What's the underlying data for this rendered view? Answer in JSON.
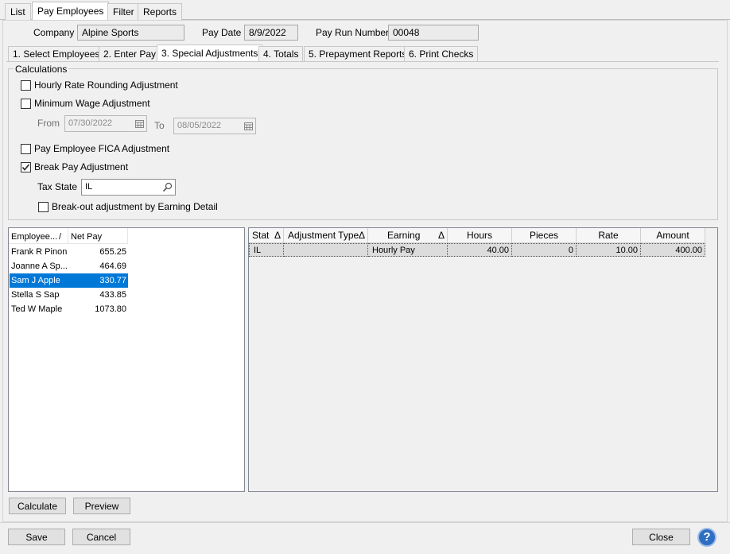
{
  "top_tabs": [
    "List",
    "Pay Employees",
    "Filter",
    "Reports"
  ],
  "header": {
    "company_label": "Company",
    "company_value": "Alpine Sports",
    "paydate_label": "Pay Date",
    "paydate_value": "8/9/2022",
    "payrun_label": "Pay Run Number",
    "payrun_value": "00048"
  },
  "step_tabs": [
    "1. Select Employees",
    "2. Enter Pay",
    "3. Special Adjustments",
    "4. Totals",
    "5. Prepayment Reports",
    "6. Print Checks"
  ],
  "calc": {
    "group_label": "Calculations",
    "hourly_rounding": "Hourly Rate Rounding Adjustment",
    "min_wage": "Minimum Wage Adjustment",
    "from_label": "From",
    "from_value": "07/30/2022",
    "to_label": "To",
    "to_value": "08/05/2022",
    "fica": "Pay Employee FICA Adjustment",
    "break_pay": "Break Pay Adjustment",
    "tax_state_label": "Tax State",
    "tax_state_value": "IL",
    "breakout": "Break-out adjustment by Earning Detail"
  },
  "emp_list": {
    "col_employee": "Employee...",
    "sort_glyph": "/",
    "col_netpay": "Net Pay",
    "rows": [
      {
        "name": "Frank R Pinon",
        "net": "655.25"
      },
      {
        "name": "Joanne A Sp...",
        "net": "464.69"
      },
      {
        "name": "Sam J Apple",
        "net": "330.77"
      },
      {
        "name": "Stella S Sap",
        "net": "433.85"
      },
      {
        "name": "Ted W Maple",
        "net": "1073.80"
      }
    ]
  },
  "adj_grid": {
    "headers": [
      "Stat",
      "Adjustment Type",
      "Earning",
      "Hours",
      "Pieces",
      "Rate",
      "Amount"
    ],
    "sort_glyph": "Δ",
    "row": {
      "stat": "IL",
      "adj_type": "",
      "earning": "Hourly Pay",
      "hours": "40.00",
      "pieces": "0",
      "rate": "10.00",
      "amount": "400.00"
    }
  },
  "buttons": {
    "calculate": "Calculate",
    "preview": "Preview",
    "save": "Save",
    "cancel": "Cancel",
    "close": "Close"
  }
}
